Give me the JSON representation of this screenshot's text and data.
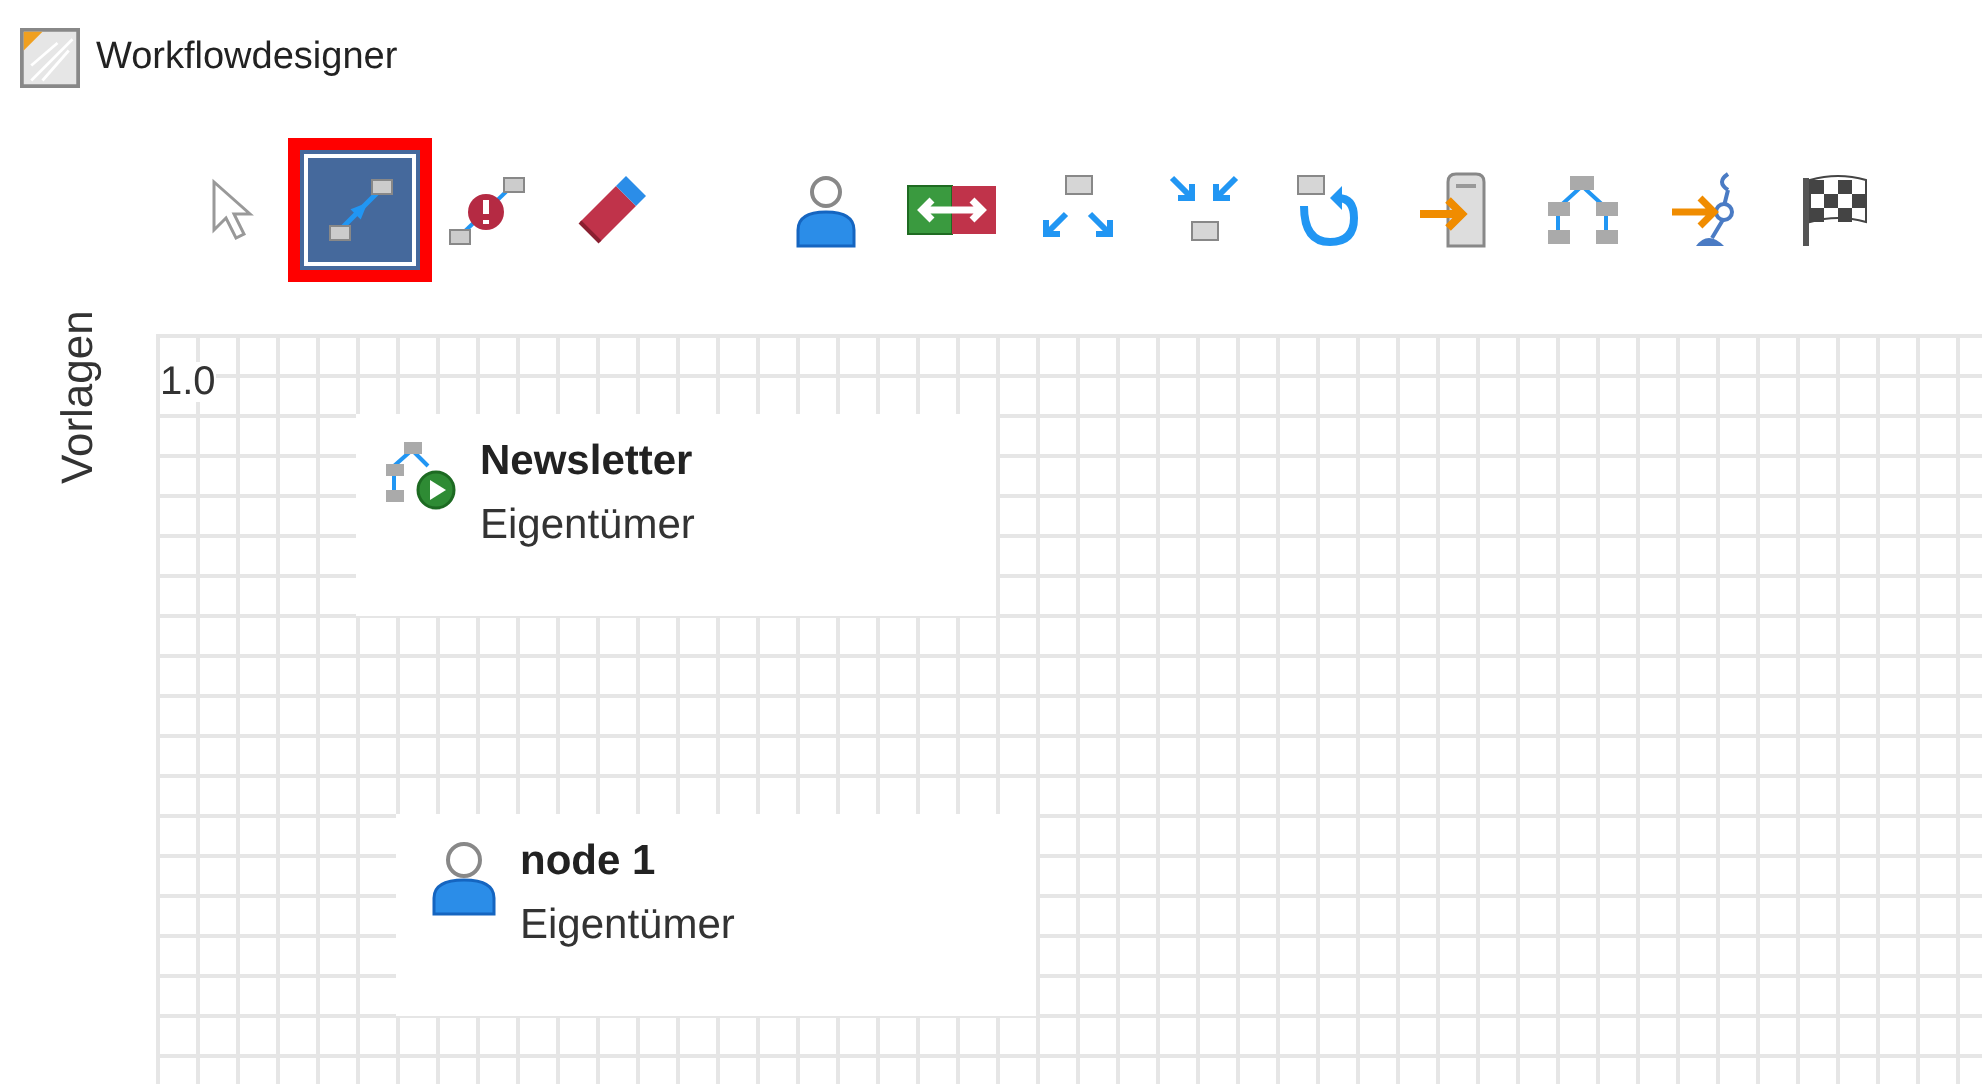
{
  "window": {
    "title": "Workflowdesigner"
  },
  "side_tab": {
    "label": "Vorlagen"
  },
  "tool_groups": [
    {
      "tools": [
        {
          "kind": "pointer",
          "selected": false
        },
        {
          "kind": "connect",
          "selected": true
        },
        {
          "kind": "error-connect",
          "selected": false
        },
        {
          "kind": "eraser",
          "selected": false
        }
      ]
    },
    {
      "tools": [
        {
          "kind": "person",
          "selected": false
        },
        {
          "kind": "swap",
          "selected": false
        },
        {
          "kind": "split",
          "selected": false
        },
        {
          "kind": "join",
          "selected": false
        },
        {
          "kind": "loop",
          "selected": false
        },
        {
          "kind": "enter",
          "selected": false
        },
        {
          "kind": "tree",
          "selected": false
        },
        {
          "kind": "merge",
          "selected": false
        },
        {
          "kind": "finish",
          "selected": false
        }
      ]
    }
  ],
  "canvas": {
    "version": "1.0",
    "nodes": [
      {
        "kind": "workflow",
        "title": "Newsletter",
        "subtitle": "Eigentümer"
      },
      {
        "kind": "person",
        "title": "node 1",
        "subtitle": "Eigentümer"
      }
    ]
  }
}
